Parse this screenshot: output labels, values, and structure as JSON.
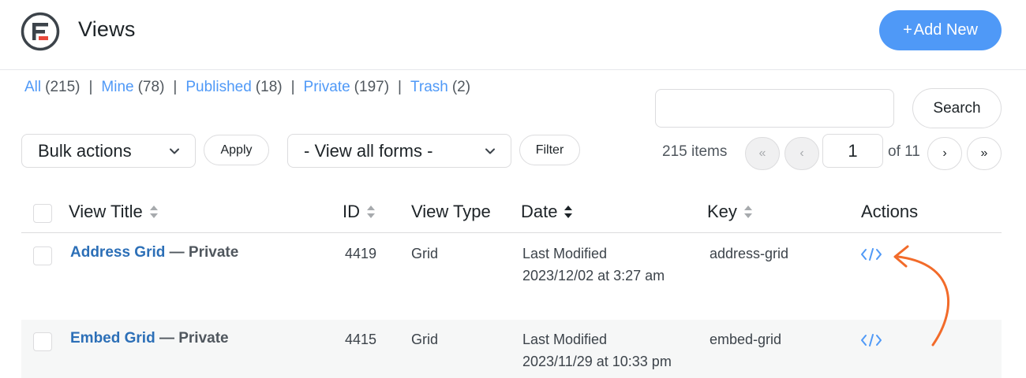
{
  "header": {
    "title": "Views",
    "add_new_label": "Add New",
    "add_new_prefix": "+"
  },
  "filters": [
    {
      "label": "All",
      "count": "(215)"
    },
    {
      "label": "Mine",
      "count": "(78)"
    },
    {
      "label": "Published",
      "count": "(18)"
    },
    {
      "label": "Private",
      "count": "(197)"
    },
    {
      "label": "Trash",
      "count": "(2)"
    }
  ],
  "search": {
    "button_label": "Search",
    "value": ""
  },
  "toolbar": {
    "bulk_actions": "Bulk actions",
    "apply": "Apply",
    "forms_select": "- View all forms -",
    "filter": "Filter"
  },
  "pagination": {
    "items": "215 items",
    "first": "«",
    "prev": "‹",
    "current": "1",
    "of": "of 11",
    "next": "›",
    "last": "»"
  },
  "columns": {
    "title": "View Title",
    "id": "ID",
    "type": "View Type",
    "date": "Date",
    "key": "Key",
    "actions": "Actions"
  },
  "rows": [
    {
      "title": "Address Grid",
      "state": " — Private",
      "id": "4419",
      "type": "Grid",
      "date_line1": "Last Modified",
      "date_line2": "2023/12/02 at 3:27 am",
      "key": "address-grid"
    },
    {
      "title": "Embed Grid",
      "state": " — Private",
      "id": "4415",
      "type": "Grid",
      "date_line1": "Last Modified",
      "date_line2": "2023/11/29 at 10:33 pm",
      "key": "embed-grid"
    }
  ],
  "colors": {
    "accent": "#4f99f7",
    "link": "#2c6fb7",
    "arrow": "#f26b2a",
    "logo_red": "#e8483b"
  },
  "icons": {
    "logo": "formidable-logo",
    "embed": "code-embed-icon",
    "sort": "sort-arrows-icon",
    "chevron": "chevron-down-icon"
  }
}
